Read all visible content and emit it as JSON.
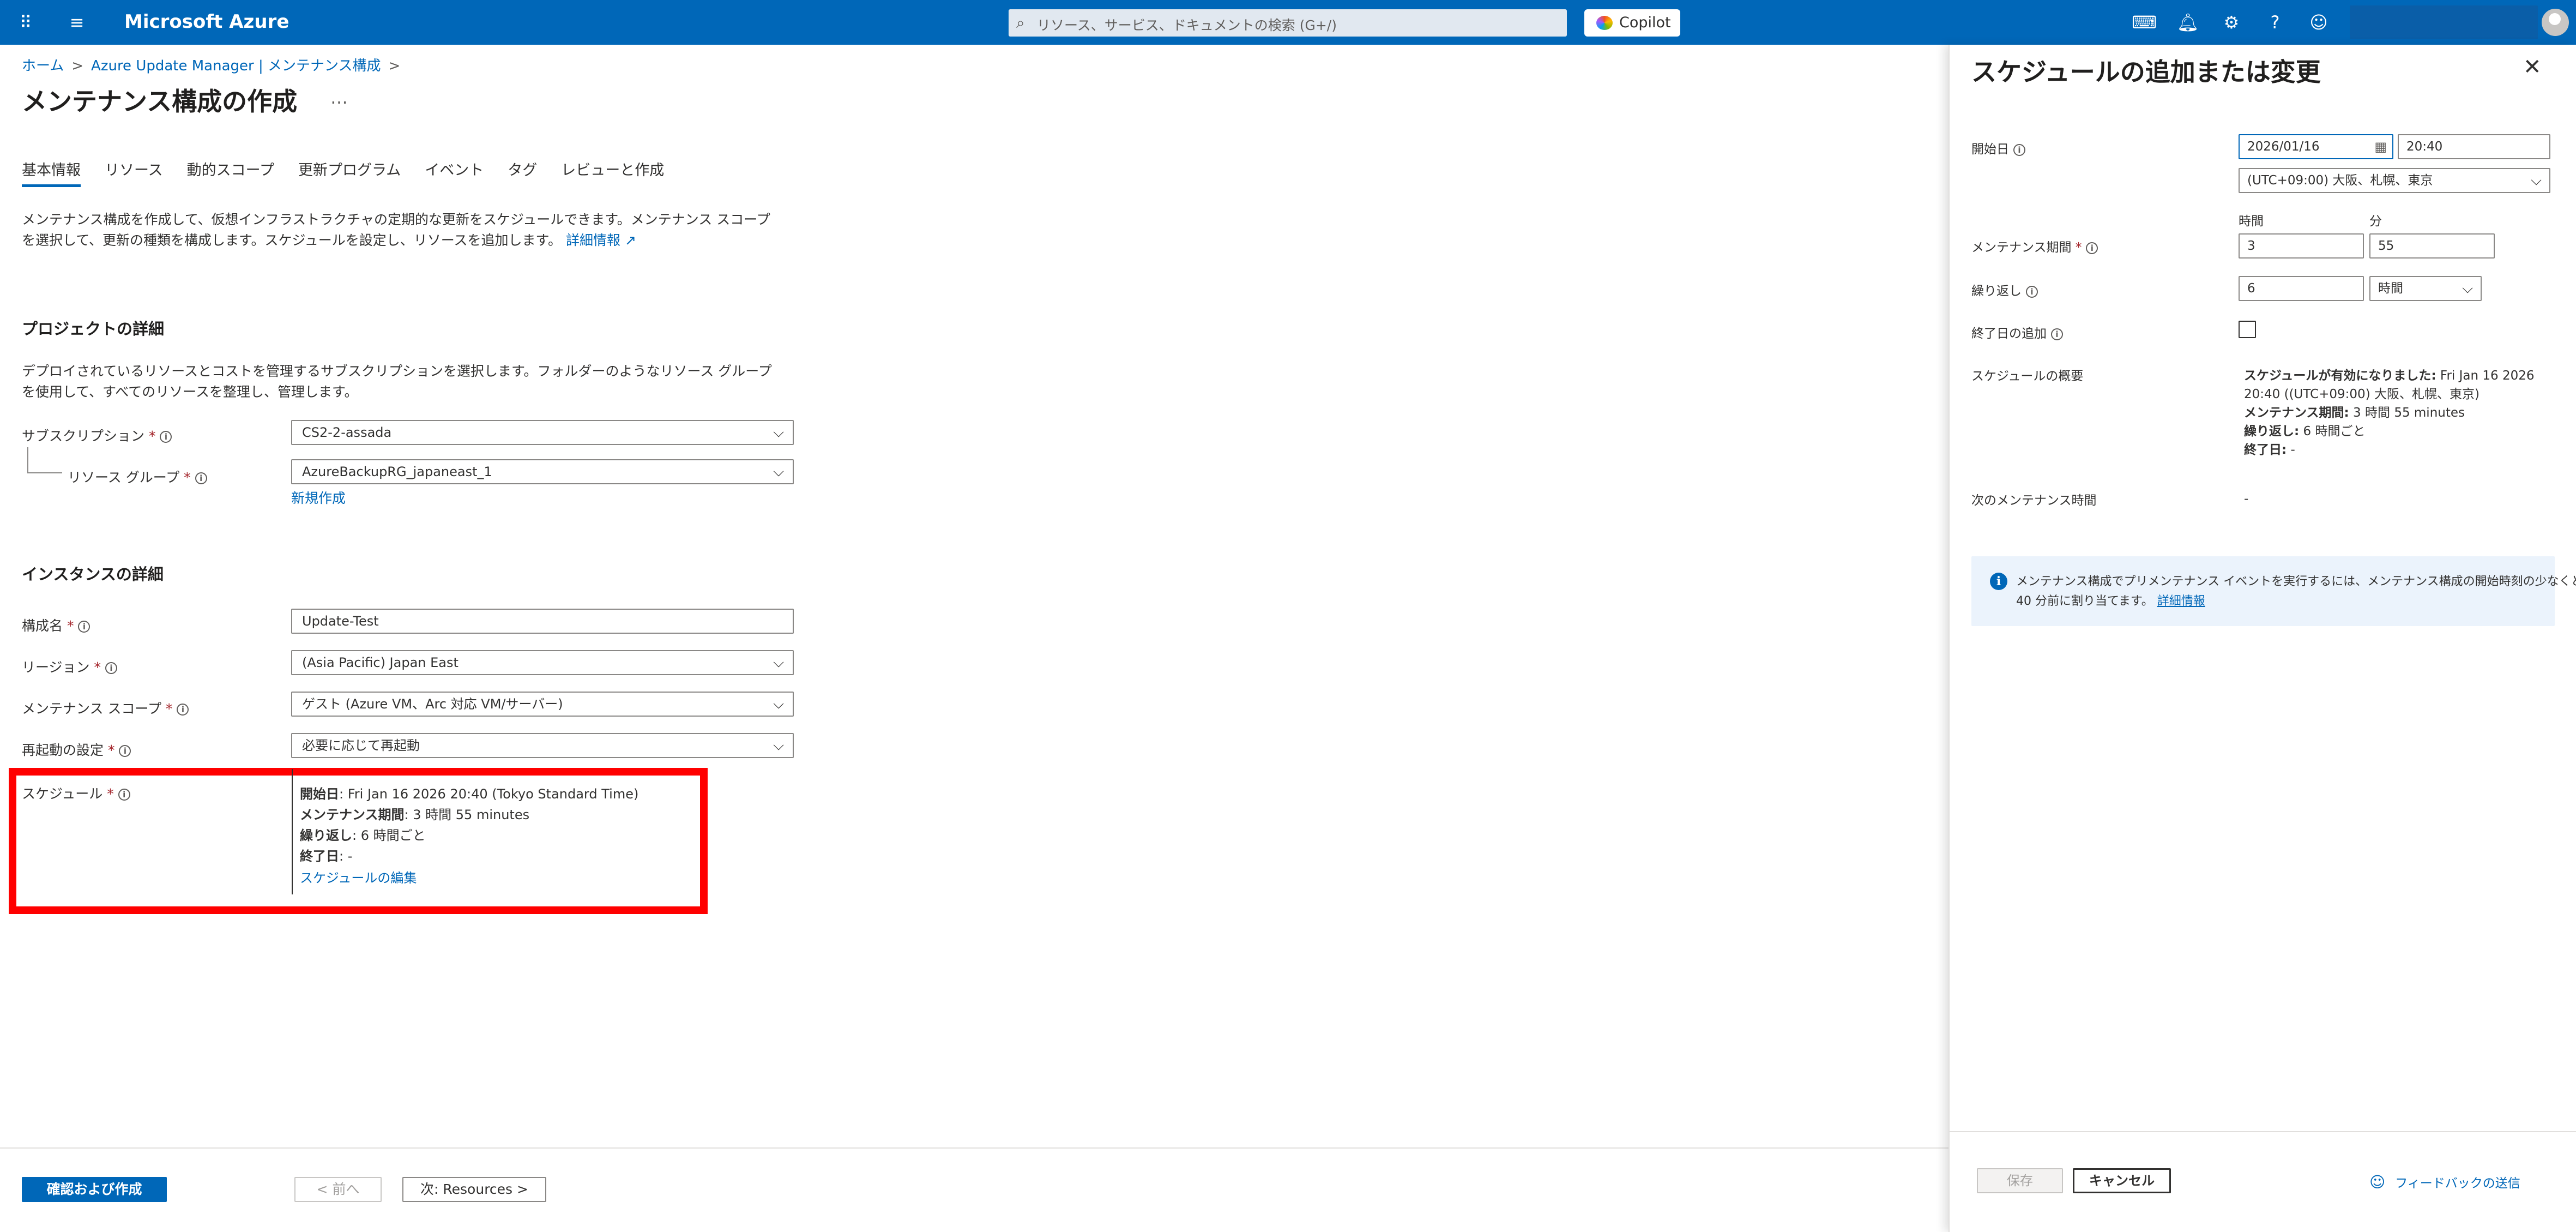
{
  "topbar": {
    "brand": "Microsoft Azure",
    "search_placeholder": "リソース、サービス、ドキュメントの検索 (G+/)",
    "copilot_label": "Copilot",
    "icons": [
      "waffle-icon",
      "hamburger-icon",
      "cloud-shell-icon",
      "bell-icon",
      "gear-icon",
      "help-icon",
      "feedback-icon"
    ]
  },
  "breadcrumb": {
    "home": "ホーム",
    "parent": "Azure Update Manager | メンテナンス構成"
  },
  "page": {
    "title": "メンテナンス構成の作成",
    "more": "…"
  },
  "tabs": [
    "基本情報",
    "リソース",
    "動的スコープ",
    "更新プログラム",
    "イベント",
    "タグ",
    "レビューと作成"
  ],
  "intro": {
    "line1": "メンテナンス構成を作成して、仮想インフラストラクチャの定期的な更新をスケジュールできます。メンテナンス スコープ",
    "line2": "を選択して、更新の種類を構成します。スケジュールを設定し、リソースを追加します。",
    "link": "詳細情報"
  },
  "project": {
    "heading": "プロジェクトの詳細",
    "desc1": "デプロイされているリソースとコストを管理するサブスクリプションを選択します。フォルダーのようなリソース グループ",
    "desc2": "を使用して、すべてのリソースを整理し、管理します。",
    "subscription_label": "サブスクリプション",
    "subscription_value": "CS2-2-assada",
    "rg_label": "リソース グループ",
    "rg_value": "AzureBackupRG_japaneast_1",
    "new_link": "新規作成"
  },
  "instance": {
    "heading": "インスタンスの詳細",
    "name_label": "構成名",
    "name_value": "Update-Test",
    "region_label": "リージョン",
    "region_value": "(Asia Pacific) Japan East",
    "scope_label": "メンテナンス スコープ",
    "scope_value": "ゲスト (Azure VM、Arc 対応 VM/サーバー)",
    "reboot_label": "再起動の設定",
    "reboot_value": "必要に応じて再起動",
    "schedule_label": "スケジュール",
    "schedule": {
      "start_key": "開始日",
      "start_val": ": Fri Jan 16 2026 20:40 (Tokyo Standard Time)",
      "duration_key": "メンテナンス期間",
      "duration_val": ": 3 時間 55 minutes",
      "repeat_key": "繰り返し",
      "repeat_val": ": 6 時間ごと",
      "end_key": "終了日",
      "end_val": ": -",
      "edit_link": "スケジュールの編集"
    }
  },
  "footer": {
    "review_button": "確認および作成",
    "prev_button": "< 前へ",
    "next_button": "次: Resources >"
  },
  "panel": {
    "title": "スケジュールの追加または変更",
    "start_label": "開始日",
    "start_date": "2026/01/16",
    "start_time": "20:40",
    "timezone": "(UTC+09:00) 大阪、札幌、東京",
    "hours_head": "時間",
    "minutes_head": "分",
    "duration_label": "メンテナンス期間",
    "duration_hours": "3",
    "duration_minutes": "55",
    "repeat_label": "繰り返し",
    "repeat_value": "6",
    "repeat_unit": "時間",
    "enddate_label": "終了日の追加",
    "summary_label": "スケジュールの概要",
    "summary": {
      "l1_key": "スケジュールが有効になりました:",
      "l1_val": " Fri Jan 16 2026",
      "l2": "20:40 ((UTC+09:00) 大阪、札幌、東京)",
      "l3_key": "メンテナンス期間:",
      "l3_val": " 3 時間 55 minutes",
      "l4_key": "繰り返し:",
      "l4_val": " 6 時間ごと",
      "l5_key": "終了日:",
      "l5_val": " -"
    },
    "next_label": "次のメンテナンス時間",
    "next_value": "-",
    "banner_line1": "メンテナンス構成でプリメンテナンス イベントを実行するには、メンテナンス構成の開始時刻の少なくとも",
    "banner_line2": "40 分前に割り当てます。",
    "banner_link": "詳細情報",
    "save_button": "保存",
    "cancel_button": "キャンセル",
    "feedback": "フィードバックの送信"
  }
}
